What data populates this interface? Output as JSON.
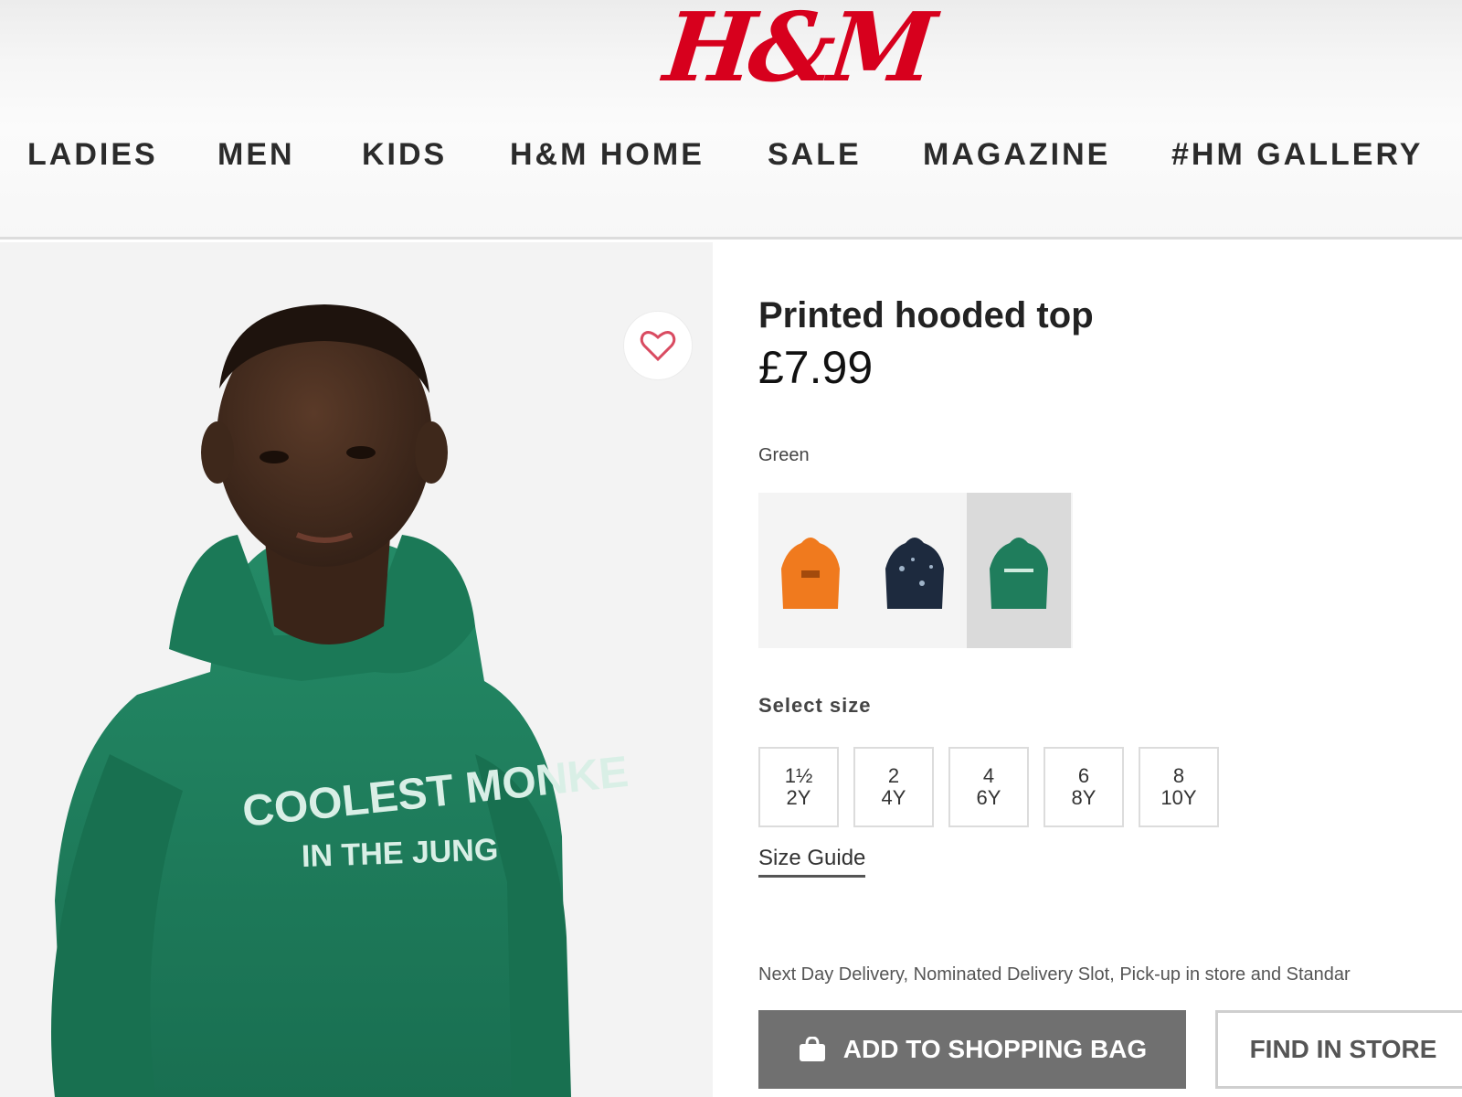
{
  "header": {
    "logo": "H&M",
    "logo_color": "#d7001d",
    "nav": [
      "LADIES",
      "MEN",
      "KIDS",
      "H&M HOME",
      "SALE",
      "MAGAZINE",
      "#HM GALLERY"
    ]
  },
  "product": {
    "title": "Printed hooded top",
    "price": "£7.99",
    "print_text": [
      "COOLEST MONKE",
      "IN THE JUNG"
    ],
    "favorite_icon": "heart-outline-icon",
    "color": {
      "selected_label": "Green",
      "swatches": [
        {
          "name": "orange",
          "hex": "#f07a1e"
        },
        {
          "name": "navy-print",
          "hex": "#1d2a3e"
        },
        {
          "name": "green",
          "hex": "#1f7d5c",
          "selected": true
        }
      ]
    },
    "size": {
      "label": "Select size",
      "options": [
        {
          "line1": "1½",
          "line2": "2Y"
        },
        {
          "line1": "2",
          "line2": "4Y"
        },
        {
          "line1": "4",
          "line2": "6Y"
        },
        {
          "line1": "6",
          "line2": "8Y"
        },
        {
          "line1": "8",
          "line2": "10Y"
        }
      ],
      "guide_label": "Size Guide"
    },
    "delivery_text": "Next Day Delivery, Nominated Delivery Slot, Pick-up in store and Standar",
    "add_to_bag_label": "ADD TO SHOPPING BAG",
    "add_to_bag_icon": "shopping-bag-icon",
    "find_in_store_label": "FIND IN STORE"
  }
}
